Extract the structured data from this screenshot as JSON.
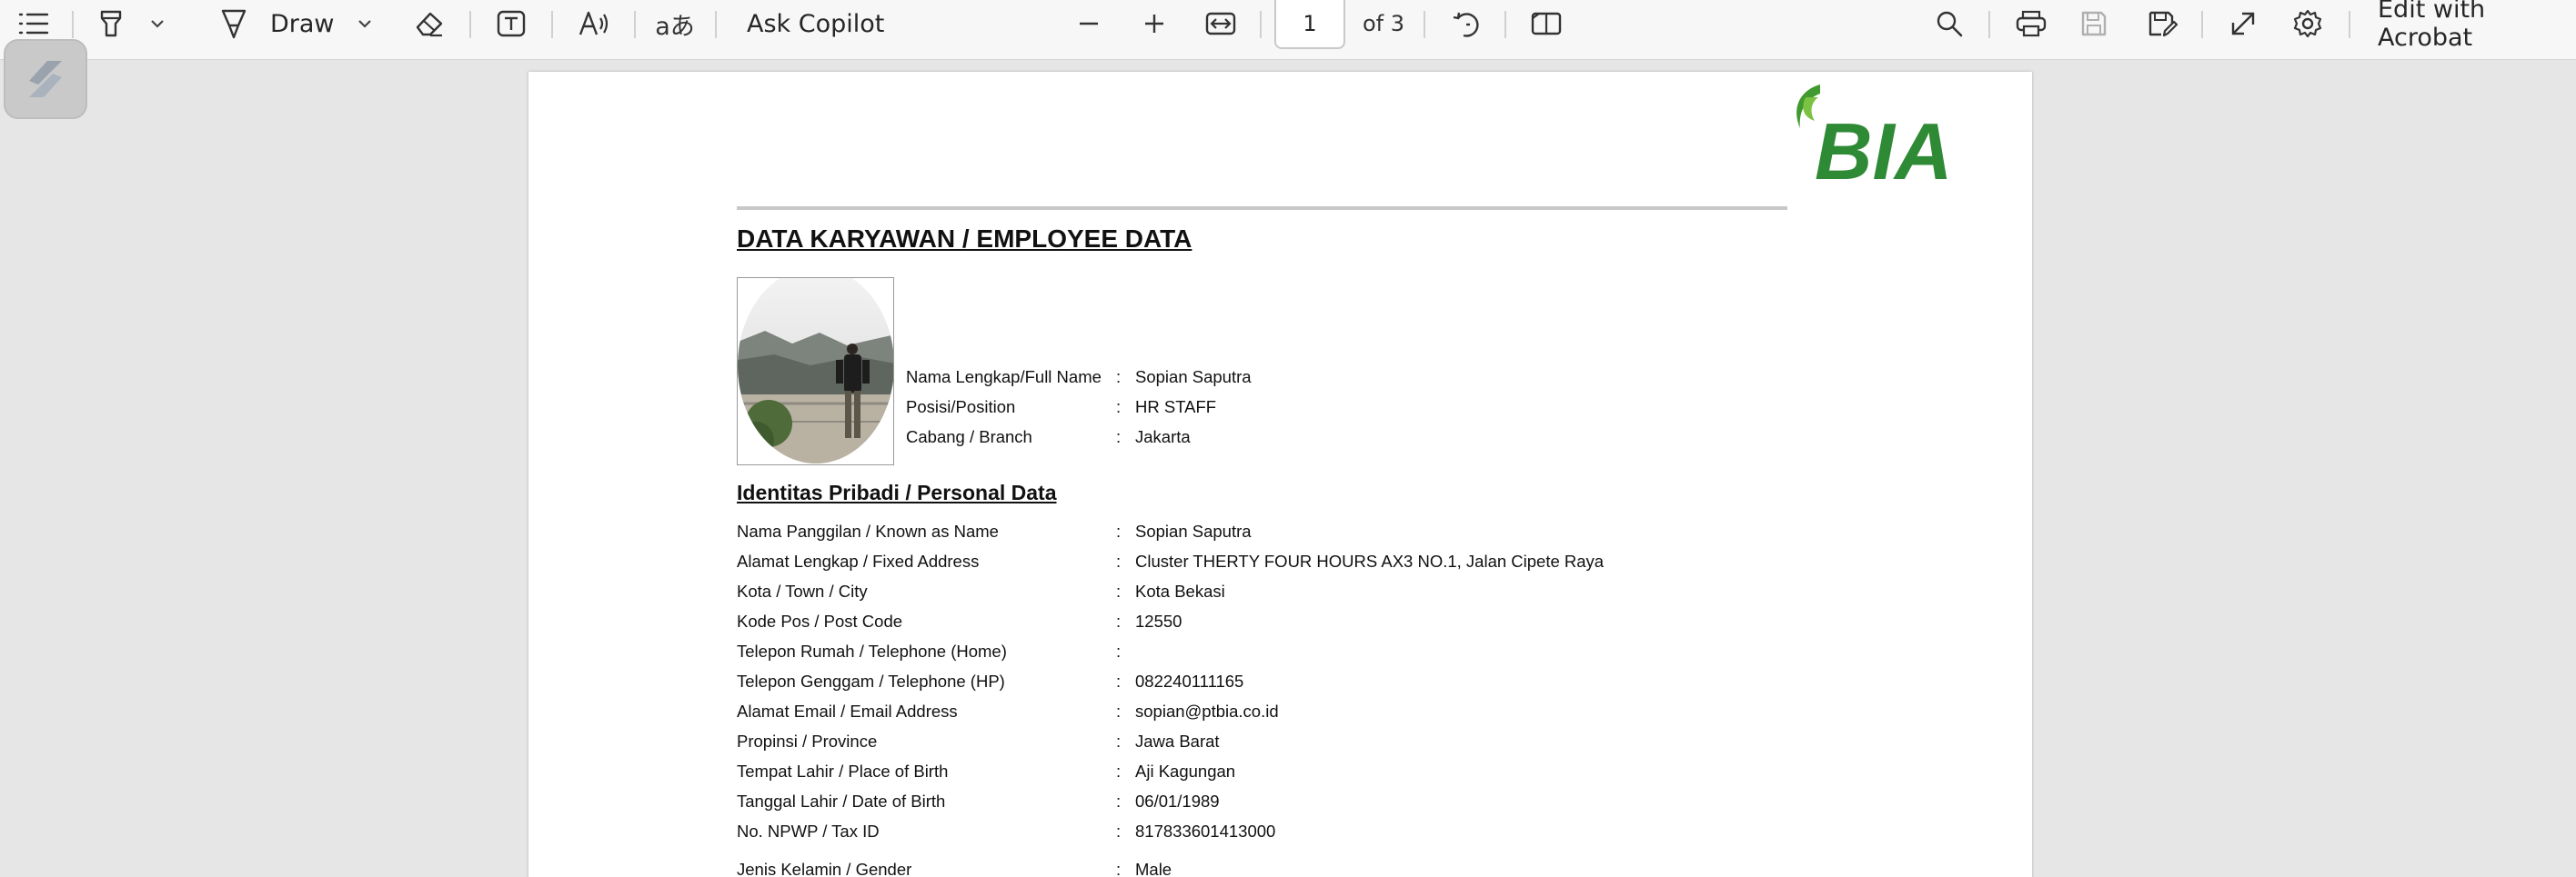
{
  "toolbar": {
    "draw_label": "Draw",
    "ask_copilot_label": "Ask Copilot",
    "page_number": "1",
    "page_of": "of 3",
    "edit_acrobat_label": "Edit with Acrobat"
  },
  "document": {
    "logo_text": "BIA",
    "title": "DATA KARYAWAN / EMPLOYEE DATA",
    "header_fields": [
      {
        "label": "Nama Lengkap/Full Name",
        "value": "Sopian Saputra"
      },
      {
        "label": "Posisi/Position",
        "value": "HR STAFF"
      },
      {
        "label": "Cabang / Branch",
        "value": "Jakarta"
      }
    ],
    "personal_section_title": "Identitas Pribadi / Personal Data",
    "personal_fields": [
      {
        "label": "Nama Panggilan / Known as Name",
        "value": "Sopian Saputra"
      },
      {
        "label": "Alamat Lengkap / Fixed Address",
        "value": "Cluster THERTY FOUR HOURS AX3 NO.1, Jalan Cipete Raya"
      },
      {
        "label": "Kota / Town / City",
        "value": "Kota Bekasi"
      },
      {
        "label": "Kode Pos / Post Code",
        "value": "12550"
      },
      {
        "label": "Telepon Rumah / Telephone (Home)",
        "value": ""
      },
      {
        "label": "Telepon Genggam / Telephone (HP)",
        "value": "082240111165"
      },
      {
        "label": "Alamat Email / Email Address",
        "value": "sopian@ptbia.co.id"
      },
      {
        "label": "Propinsi / Province",
        "value": "Jawa Barat"
      },
      {
        "label": "Tempat Lahir / Place of Birth",
        "value": "Aji Kagungan"
      },
      {
        "label": "Tanggal Lahir / Date of Birth",
        "value": "06/01/1989"
      },
      {
        "label": "No. NPWP / Tax ID",
        "value": "817833601413000"
      },
      {
        "label": "Jenis Kelamin / Gender",
        "value": "Male"
      }
    ],
    "colon": ":"
  },
  "colors": {
    "logo_green": "#3f9a2f",
    "logo_green_dark": "#2c6e2a"
  }
}
